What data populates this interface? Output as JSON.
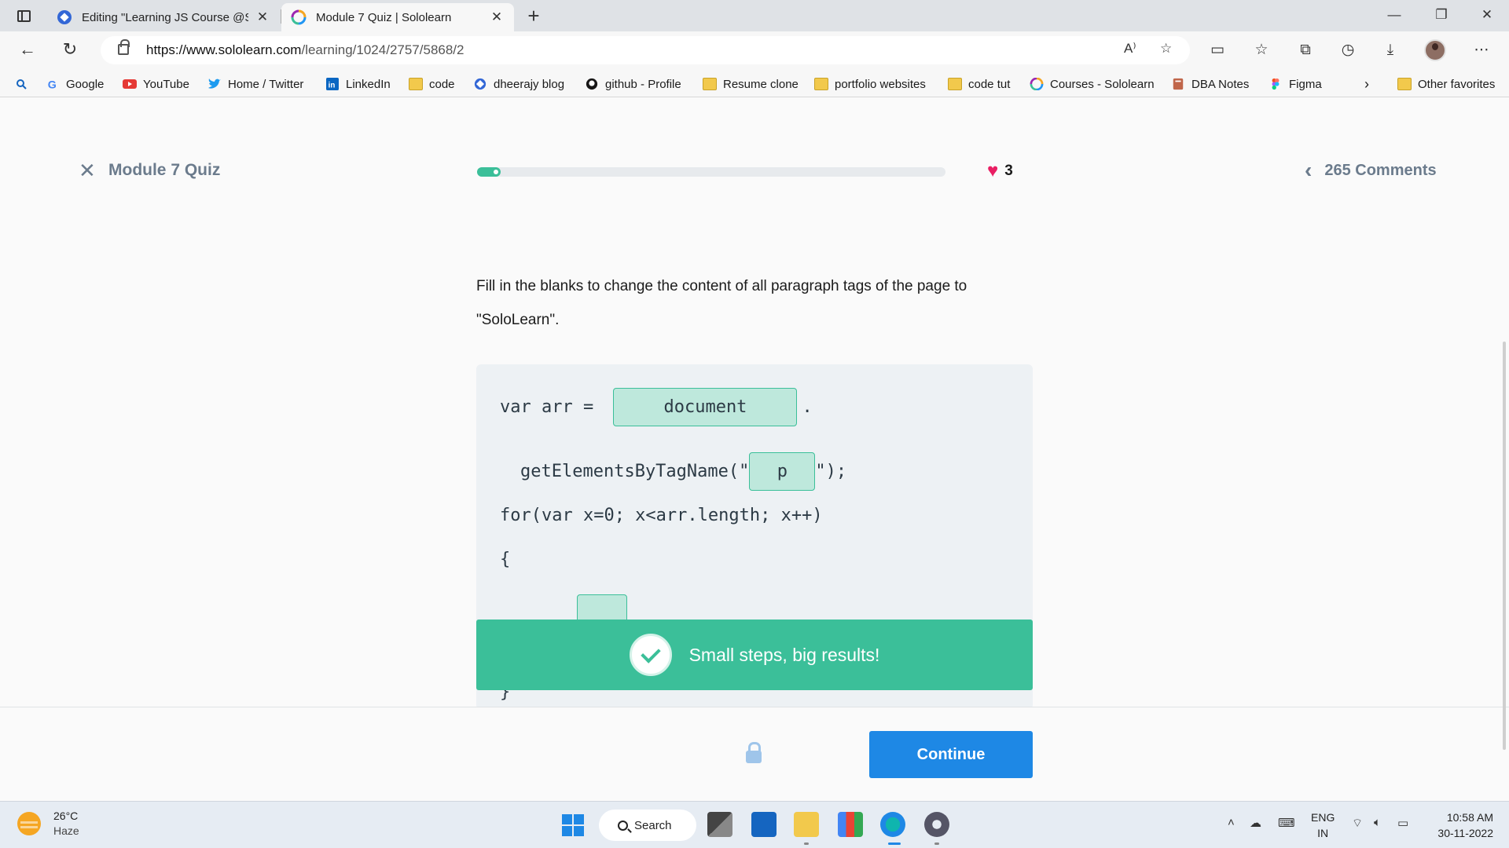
{
  "browser": {
    "tabs": [
      {
        "title": "Editing \"Learning JS Course @Sc",
        "active": false
      },
      {
        "title": "Module 7 Quiz | Sololearn",
        "active": true
      }
    ],
    "url_host": "https://www.sololearn.com",
    "url_path": "/learning/1024/2757/5868/2",
    "favorites": [
      {
        "label": "Google",
        "icon": "google-icon"
      },
      {
        "label": "YouTube",
        "icon": "youtube-icon"
      },
      {
        "label": "Home / Twitter",
        "icon": "twitter-icon"
      },
      {
        "label": "LinkedIn",
        "icon": "linkedin-icon"
      },
      {
        "label": "code",
        "icon": "folder-icon"
      },
      {
        "label": "dheerajy blog",
        "icon": "blog-icon"
      },
      {
        "label": "github - Profile",
        "icon": "github-icon"
      },
      {
        "label": "Resume clone",
        "icon": "folder-icon"
      },
      {
        "label": "portfolio websites",
        "icon": "folder-icon"
      },
      {
        "label": "code tut",
        "icon": "folder-icon"
      },
      {
        "label": "Courses - Sololearn",
        "icon": "sololearn-icon"
      },
      {
        "label": "DBA Notes",
        "icon": "notes-icon"
      },
      {
        "label": "Figma",
        "icon": "figma-icon"
      }
    ],
    "other_favorites": "Other favorites"
  },
  "quiz": {
    "title": "Module 7 Quiz",
    "progress_fraction": 0.05,
    "lives": "3",
    "comments": "265 Comments",
    "question": "Fill in the blanks to change the content of all paragraph tags of the page to \"SoloLearn\".",
    "code": {
      "line1_prefix": "var arr = ",
      "blank1": "document",
      "line1_suffix": ".",
      "line2_prefix": "getElementsByTagName(\"",
      "blank2": "p",
      "line2_suffix": "\");",
      "line3": "for(var x=0; x<arr.length; x++)",
      "line4": "{",
      "line6": "}"
    },
    "toast": "Small steps, big results!",
    "continue": "Continue"
  },
  "colors": {
    "accent_green": "#3bbf99",
    "button_blue": "#1e88e5",
    "heart": "#e91e63"
  },
  "taskbar": {
    "temperature": "26°C",
    "condition": "Haze",
    "search": "Search",
    "lang1": "ENG",
    "lang2": "IN",
    "time": "10:58 AM",
    "date": "30-11-2022"
  }
}
